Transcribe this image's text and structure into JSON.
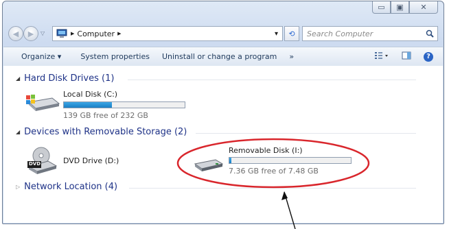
{
  "window": {
    "minimize_glyph": "▭",
    "maximize_glyph": "▣",
    "close_glyph": "✕"
  },
  "address": {
    "arrow1": "▶",
    "location": "Computer",
    "arrow2": "▶",
    "dropdown": "▾"
  },
  "search": {
    "placeholder": "Search Computer"
  },
  "toolbar": {
    "organize": "Organize ▾",
    "system_properties": "System properties",
    "uninstall": "Uninstall or change a program",
    "more": "»",
    "help": "?"
  },
  "groups": {
    "hard_disk": {
      "title": "Hard Disk Drives (1)"
    },
    "removable": {
      "title": "Devices with Removable Storage (2)"
    },
    "network": {
      "title": "Network Location (4)"
    }
  },
  "drives": {
    "local": {
      "name": "Local Disk (C:)",
      "free_text": "139 GB free of 232 GB",
      "used_fraction": 0.4
    },
    "dvd": {
      "name": "DVD Drive (D:)",
      "icon_label": "DVD"
    },
    "removable": {
      "name": "Removable Disk (I:)",
      "free_text": "7.36 GB free of 7.48 GB",
      "used_fraction": 0.016
    }
  },
  "colors": {
    "group_title": "#1e3287",
    "bar_fill": "#1b7fc4",
    "annotation": "#d9262c"
  }
}
